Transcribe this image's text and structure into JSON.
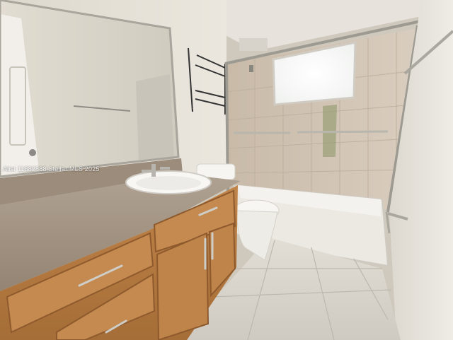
{
  "photo": {
    "subject": "bathroom",
    "watermark": "Alist 11882888 Stellar MLS 2025",
    "colors": {
      "ceiling": "#e7e3dc",
      "wall": "#e1ddd3",
      "tile_floor": "#e4e0d8",
      "shower_tile": "#cfc2b2",
      "countertop": "#a49484",
      "cabinet": "#b57a42",
      "cabinet_dark": "#8e5a2d",
      "chrome": "#b8b5ae",
      "window_glow": "#fbfbf7"
    }
  }
}
